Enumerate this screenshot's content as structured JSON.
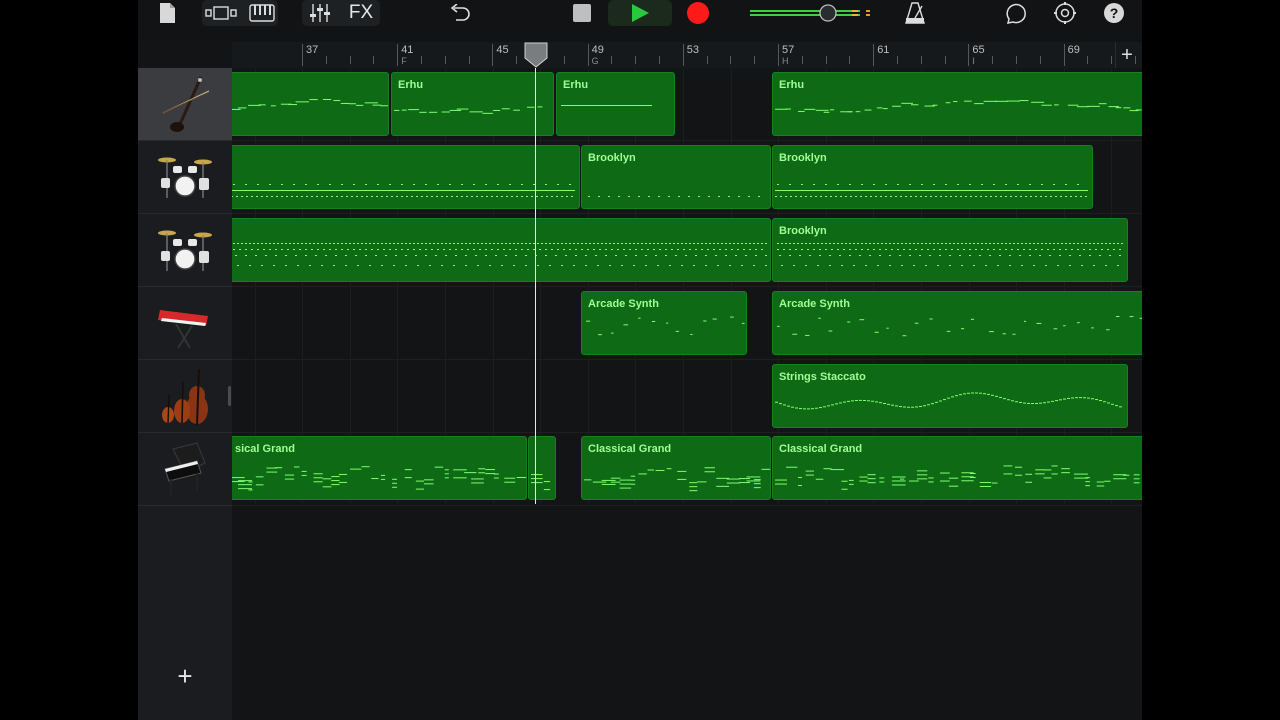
{
  "toolbar": {
    "icons": [
      "my-songs-icon",
      "browser-icon",
      "keyboard-icon",
      "mixer-icon",
      "fx-label",
      "undo-icon",
      "stop-icon",
      "play-icon",
      "record-icon",
      "master-volume-slider",
      "metronome-icon",
      "loop-icon",
      "settings-icon",
      "help-icon"
    ],
    "fx_label": "FX",
    "accent_play": "#27c93f",
    "accent_record": "#ff1a1a",
    "master_volume_level": 0.72
  },
  "ruler": {
    "bars": [
      {
        "num": "37",
        "sec": ""
      },
      {
        "num": "41",
        "sec": "F"
      },
      {
        "num": "45",
        "sec": ""
      },
      {
        "num": "49",
        "sec": "G"
      },
      {
        "num": "53",
        "sec": ""
      },
      {
        "num": "57",
        "sec": "H"
      },
      {
        "num": "61",
        "sec": ""
      },
      {
        "num": "65",
        "sec": "I"
      },
      {
        "num": "69",
        "sec": ""
      }
    ],
    "add_label": "+"
  },
  "tracks": [
    {
      "instrument": "erhu",
      "selected": true
    },
    {
      "instrument": "drum-kit",
      "selected": false
    },
    {
      "instrument": "drum-kit",
      "selected": false
    },
    {
      "instrument": "synth-keyboard",
      "selected": false
    },
    {
      "instrument": "strings",
      "selected": false
    },
    {
      "instrument": "grand-piano",
      "selected": false
    }
  ],
  "regions": {
    "erhu_1": "",
    "erhu_2": "Erhu",
    "erhu_3": "Erhu",
    "erhu_4": "Erhu",
    "drums1_1": "",
    "drums1_2": "Brooklyn",
    "drums1_3": "Brooklyn",
    "drums2_1": "",
    "drums2_2": "Brooklyn",
    "synth_1": "Arcade Synth",
    "synth_2": "Arcade Synth",
    "strings_1": "Strings Staccato",
    "piano_1": "sical Grand",
    "piano_2": "",
    "piano_3": "Classical Grand",
    "piano_4": "Classical Grand"
  },
  "add_track_label": "+",
  "colors": {
    "region": "#0e6a15",
    "region_text": "#9dff94",
    "note": "#7dff6e"
  }
}
